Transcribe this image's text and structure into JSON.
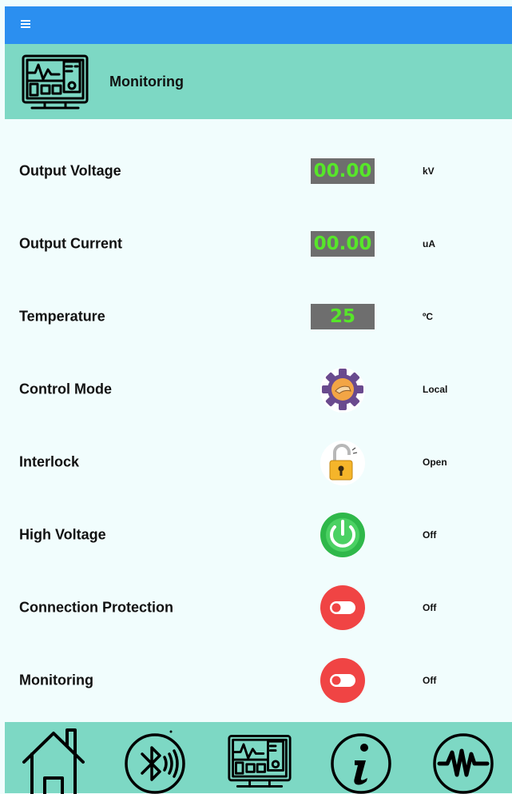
{
  "appbar": {
    "menu_icon": "hamburger-menu-icon"
  },
  "header": {
    "title": "Monitoring",
    "icon": "monitor-panel-icon"
  },
  "rows": [
    {
      "label": "Output Voltage",
      "display": "00.00",
      "unit": "kV"
    },
    {
      "label": "Output Current",
      "display": "00.00",
      "unit": "uA"
    },
    {
      "label": "Temperature",
      "display": "25",
      "unit": "ºC"
    },
    {
      "label": "Control Mode",
      "icon": "gear-hand-icon",
      "status": "Local"
    },
    {
      "label": "Interlock",
      "icon": "padlock-open-icon",
      "status": "Open"
    },
    {
      "label": "High Voltage",
      "icon": "power-icon",
      "status": "Off"
    },
    {
      "label": "Connection Protection",
      "icon": "toggle-off-icon",
      "status": "Off"
    },
    {
      "label": "Monitoring",
      "icon": "toggle-off-icon",
      "status": "Off"
    }
  ],
  "colors": {
    "appbar": "#2b8ff0",
    "header": "#7dd8c4",
    "background": "#f1fdfd",
    "display_bg": "#6e6e6e",
    "display_text": "#57e62a",
    "toggle_red": "#f04444",
    "power_green": "#2fb84a",
    "lock_gold": "#f5b52a",
    "gear_purple": "#6a4a8e"
  },
  "bottom_nav": [
    "home-icon",
    "bluetooth-icon",
    "monitor-panel-icon",
    "info-icon",
    "waveform-icon"
  ]
}
